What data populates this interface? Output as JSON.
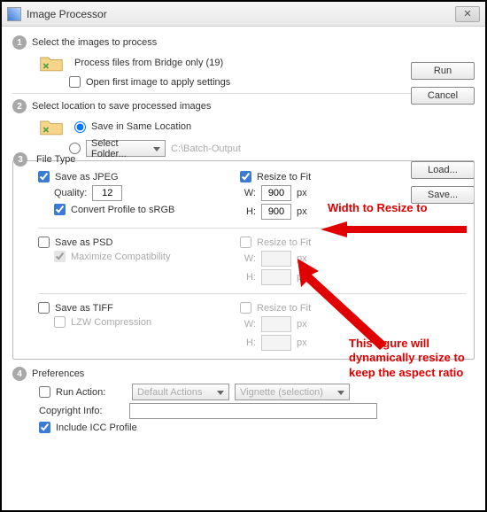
{
  "window": {
    "title": "Image Processor",
    "close_glyph": "✕"
  },
  "buttons": {
    "run": "Run",
    "cancel": "Cancel",
    "load": "Load...",
    "save": "Save..."
  },
  "step1": {
    "title": "Select the images to process",
    "bridge": "Process files from Bridge only (19)",
    "open_first": "Open first image to apply settings"
  },
  "step2": {
    "title": "Select location to save processed images",
    "same": "Save in Same Location",
    "select_folder_btn": "Select Folder...",
    "path": "C:\\Batch-Output"
  },
  "step3": {
    "title": "File Type",
    "jpeg": {
      "save": "Save as JPEG",
      "quality_label": "Quality:",
      "quality": "12",
      "srgb": "Convert Profile to sRGB",
      "resize": "Resize to Fit",
      "w_label": "W:",
      "w": "900",
      "h_label": "H:",
      "h": "900",
      "px": "px"
    },
    "psd": {
      "save": "Save as PSD",
      "maxcomp": "Maximize Compatibility",
      "resize": "Resize to Fit",
      "w_label": "W:",
      "h_label": "H:",
      "px": "px"
    },
    "tiff": {
      "save": "Save as TIFF",
      "lzw": "LZW Compression",
      "resize": "Resize to Fit",
      "w_label": "W:",
      "h_label": "H:",
      "px": "px"
    }
  },
  "step4": {
    "title": "Preferences",
    "run_action": "Run Action:",
    "action_set": "Default Actions",
    "action": "Vignette (selection)",
    "copyright": "Copyright Info:",
    "icc": "Include ICC Profile"
  },
  "anno": {
    "width": "Width to Resize to",
    "dyn": "This figure will\ndynamically resize to\nkeep the aspect ratio"
  }
}
